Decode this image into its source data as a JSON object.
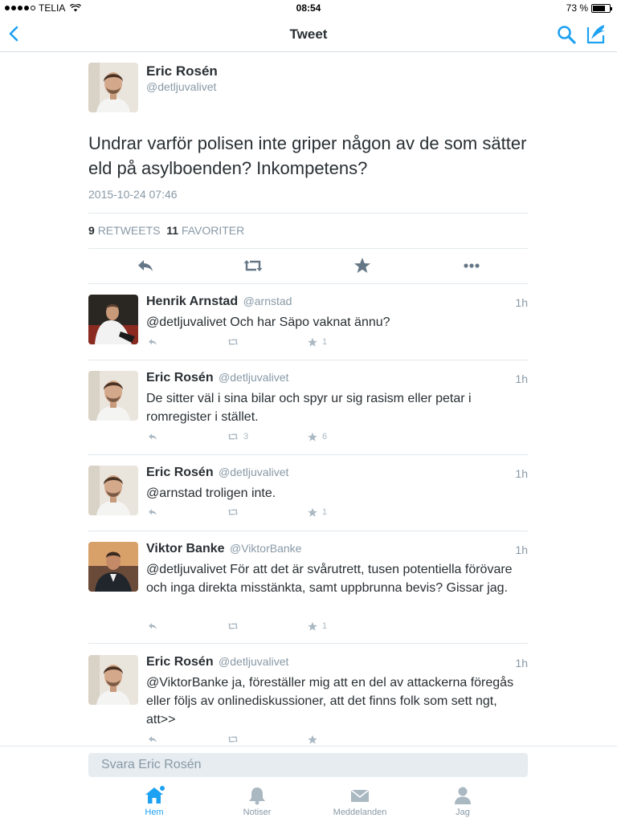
{
  "status_bar": {
    "carrier": "TELIA",
    "time": "08:54",
    "battery": "73 %",
    "battery_level": 0.73
  },
  "nav": {
    "title": "Tweet",
    "back_icon": "chevron-left-icon",
    "search_icon": "search-icon",
    "compose_icon": "compose-icon"
  },
  "main_tweet": {
    "name": "Eric Rosén",
    "handle": "@detljuvalivet",
    "text": "Undrar varför polisen inte griper någon av de som sätter eld på asylboenden? Inkompetens?",
    "date": "2015-10-24 07:46",
    "retweets_count": "9",
    "retweets_label": "RETWEETS",
    "favorites_count": "11",
    "favorites_label": "FAVORITER"
  },
  "replies": [
    {
      "name": "Henrik Arnstad",
      "handle": "@arnstad",
      "time": "1h",
      "text": "@detljuvalivet Och har Säpo vaknat ännu?",
      "retweets": "",
      "favorites": "1"
    },
    {
      "name": "Eric Rosén",
      "handle": "@detljuvalivet",
      "time": "1h",
      "text": "De sitter väl i sina bilar och spyr ur sig rasism eller petar i romregister i stället.",
      "retweets": "3",
      "favorites": "6"
    },
    {
      "name": "Eric Rosén",
      "handle": "@detljuvalivet",
      "time": "1h",
      "text": "@arnstad troligen inte.",
      "retweets": "",
      "favorites": "1"
    },
    {
      "name": "Viktor Banke",
      "handle": "@ViktorBanke",
      "time": "1h",
      "text": "@detljuvalivet För att det är svårutrett, tusen potentiella förövare och inga direkta misstänkta, samt uppbrunna bevis? Gissar jag.",
      "retweets": "",
      "favorites": "1"
    },
    {
      "name": "Eric Rosén",
      "handle": "@detljuvalivet",
      "time": "1h",
      "text": "@ViktorBanke ja, föreställer mig att en del av attackerna föregås eller följs av onlinediskussioner, att det finns folk som sett ngt, att>>",
      "retweets": "",
      "favorites": ""
    }
  ],
  "composer": {
    "placeholder": "Svara Eric Rosén"
  },
  "tabs": [
    {
      "label": "Hem",
      "icon": "home-icon"
    },
    {
      "label": "Notiser",
      "icon": "bell-icon"
    },
    {
      "label": "Meddelanden",
      "icon": "envelope-icon"
    },
    {
      "label": "Jag",
      "icon": "person-icon"
    }
  ],
  "colors": {
    "accent": "#1da1f2",
    "text": "#292f33",
    "muted": "#8899a6",
    "icon_muted": "#aab8c2"
  }
}
